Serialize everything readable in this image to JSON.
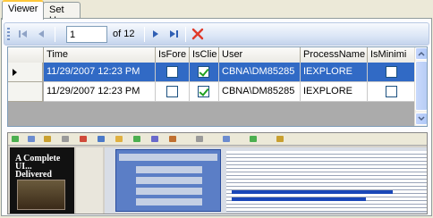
{
  "tabs": [
    {
      "label": "Viewer",
      "active": true
    },
    {
      "label": "Set Up",
      "active": false
    }
  ],
  "navigator": {
    "position": "1",
    "count_label": "of 12"
  },
  "grid": {
    "columns": [
      "Time",
      "IsFore",
      "IsClie",
      "User",
      "ProcessName",
      "IsMinimi"
    ],
    "rows": [
      {
        "time": "11/29/2007 12:23 PM",
        "is_fore": false,
        "is_client": true,
        "user": "CBNA\\DM85285",
        "process_name": "IEXPLORE",
        "is_minimized": false,
        "selected": true
      },
      {
        "time": "11/29/2007 12:23 PM",
        "is_fore": false,
        "is_client": true,
        "user": "CBNA\\DM85285",
        "process_name": "IEXPLORE",
        "is_minimized": false,
        "selected": false
      }
    ]
  },
  "preview": {
    "left_panel_title": "A Complete UI... Delivered"
  },
  "colors": {
    "selection": "#316ac5",
    "tab_accent": "#ffc83c",
    "delete_icon": "#e03a2a"
  }
}
